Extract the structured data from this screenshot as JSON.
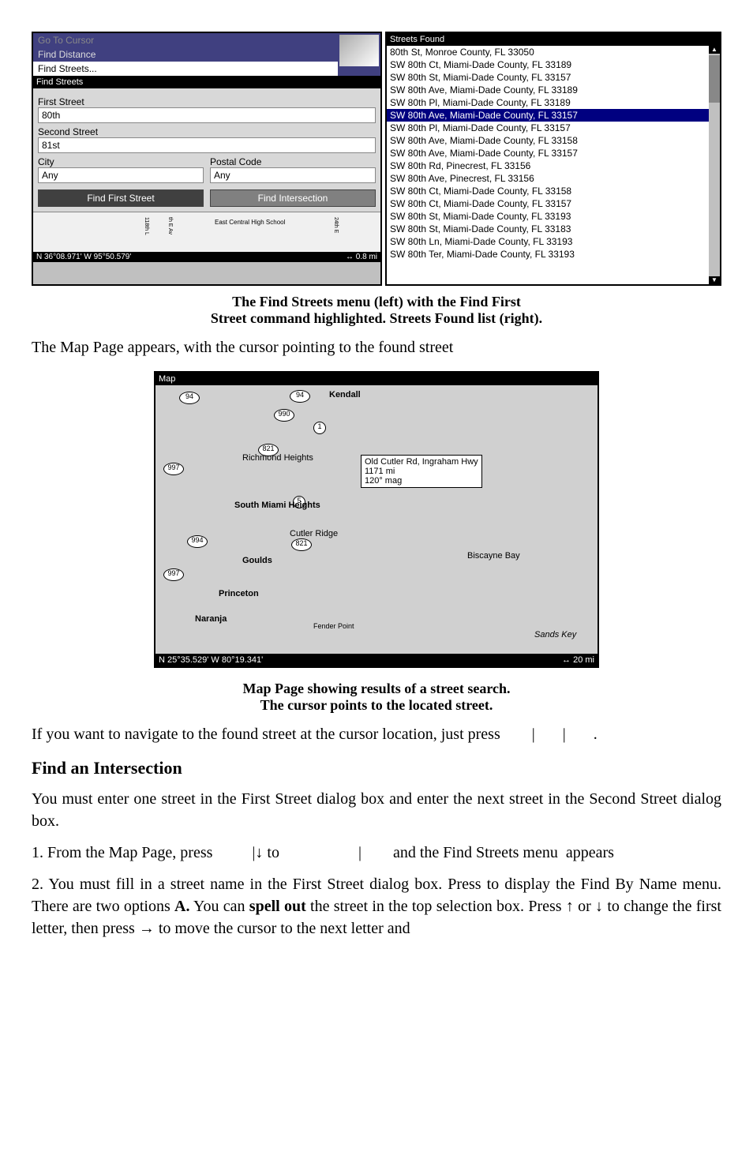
{
  "leftPanel": {
    "menu": {
      "goTo": "Go To Cursor",
      "findDistance": "Find Distance",
      "findStreets": "Find Streets..."
    },
    "header": "Find Streets",
    "labels": {
      "firstStreet": "First Street",
      "secondStreet": "Second Street",
      "city": "City",
      "postalCode": "Postal Code"
    },
    "values": {
      "firstStreet": "80th",
      "secondStreet": "81st",
      "city": "Any",
      "postalCode": "Any"
    },
    "buttons": {
      "findFirst": "Find First Street",
      "findIntersection": "Find Intersection"
    },
    "miniMap": {
      "school": "East Central High School",
      "road1": "118th L",
      "road2": "th E Av",
      "road3": "24th E"
    },
    "status": {
      "coords": "N   36°08.971'   W   95°50.579'",
      "dist": "↔    0.8 mi"
    }
  },
  "rightPanel": {
    "header": "Streets Found",
    "items": [
      "80th St, Monroe County, FL 33050",
      "SW 80th Ct, Miami-Dade County, FL 33189",
      "SW 80th St, Miami-Dade County, FL 33157",
      "SW 80th Ave, Miami-Dade County, FL 33189",
      "SW 80th Pl, Miami-Dade County, FL 33189",
      "SW 80th Ave, Miami-Dade County, FL 33157",
      "SW 80th Pl, Miami-Dade County, FL 33157",
      "SW 80th Ave, Miami-Dade County, FL 33158",
      "SW 80th Ave, Miami-Dade County, FL 33157",
      "SW 80th Rd, Pinecrest, FL 33156",
      "SW 80th Ave, Pinecrest, FL 33156",
      "SW 80th Ct, Miami-Dade County, FL 33158",
      "SW 80th Ct, Miami-Dade County, FL 33157",
      "SW 80th St, Miami-Dade County, FL 33193",
      "SW 80th St, Miami-Dade County, FL 33183",
      "SW 80th Ln, Miami-Dade County, FL 33193",
      "SW 80th Ter, Miami-Dade County, FL 33193"
    ],
    "selectedIndex": 5
  },
  "caption1a": "The Find Streets menu (left) with the Find First",
  "caption1b": "Street command highlighted. Streets Found list (right).",
  "bodyText1": "The Map Page appears, with the cursor pointing to the found street",
  "mapScreenshot": {
    "title": "Map",
    "cities": {
      "kendall": "Kendall",
      "richmond": "Richmond Heights",
      "southMiami": "South Miami Heights",
      "cutlerRidge": "Cutler Ridge",
      "goulds": "Goulds",
      "princeton": "Princeton",
      "naranja": "Naranja",
      "fender": "Fender Point",
      "biscayne": "Biscayne Bay",
      "sandsKey": "Sands Key"
    },
    "routes": {
      "r94a": "94",
      "r94b": "94",
      "r990": "990",
      "r821": "821",
      "r1": "1",
      "r5": "5",
      "r997": "997",
      "r994": "994",
      "r997b": "997",
      "r821b": "821"
    },
    "infoBox": {
      "road": "Old Cutler Rd, Ingraham Hwy",
      "dist": "1171 mi",
      "bearing": "120° mag"
    },
    "status": {
      "coords": "N   25°35.529'   W   80°19.341'",
      "dist": "↔    20 mi"
    }
  },
  "caption2a": "Map Page showing results of a street search.",
  "caption2b": "The cursor points to the located street.",
  "bodyText2": "If you want to navigate to the found street at the cursor location, just press        |       |       .",
  "heading": "Find an Intersection",
  "bodyText3": "You must enter one street in the First Street dialog box and enter the next street in the Second Street dialog box.",
  "bodyText4": "1. From the Map Page, press          |↓ to                    |        and the Find Streets menu  appears",
  "bodyText5a": "2. You must fill in a street name in the First Street dialog box. Press       to display the Find By Name menu. There are two options  ",
  "bodyText5b": "A.",
  "bodyText5c": " You can ",
  "bodyText5d": "spell out",
  "bodyText5e": " the street in the top selection box. Press ↑ or ↓ to change the first letter, then press → to move the cursor to the next letter and"
}
